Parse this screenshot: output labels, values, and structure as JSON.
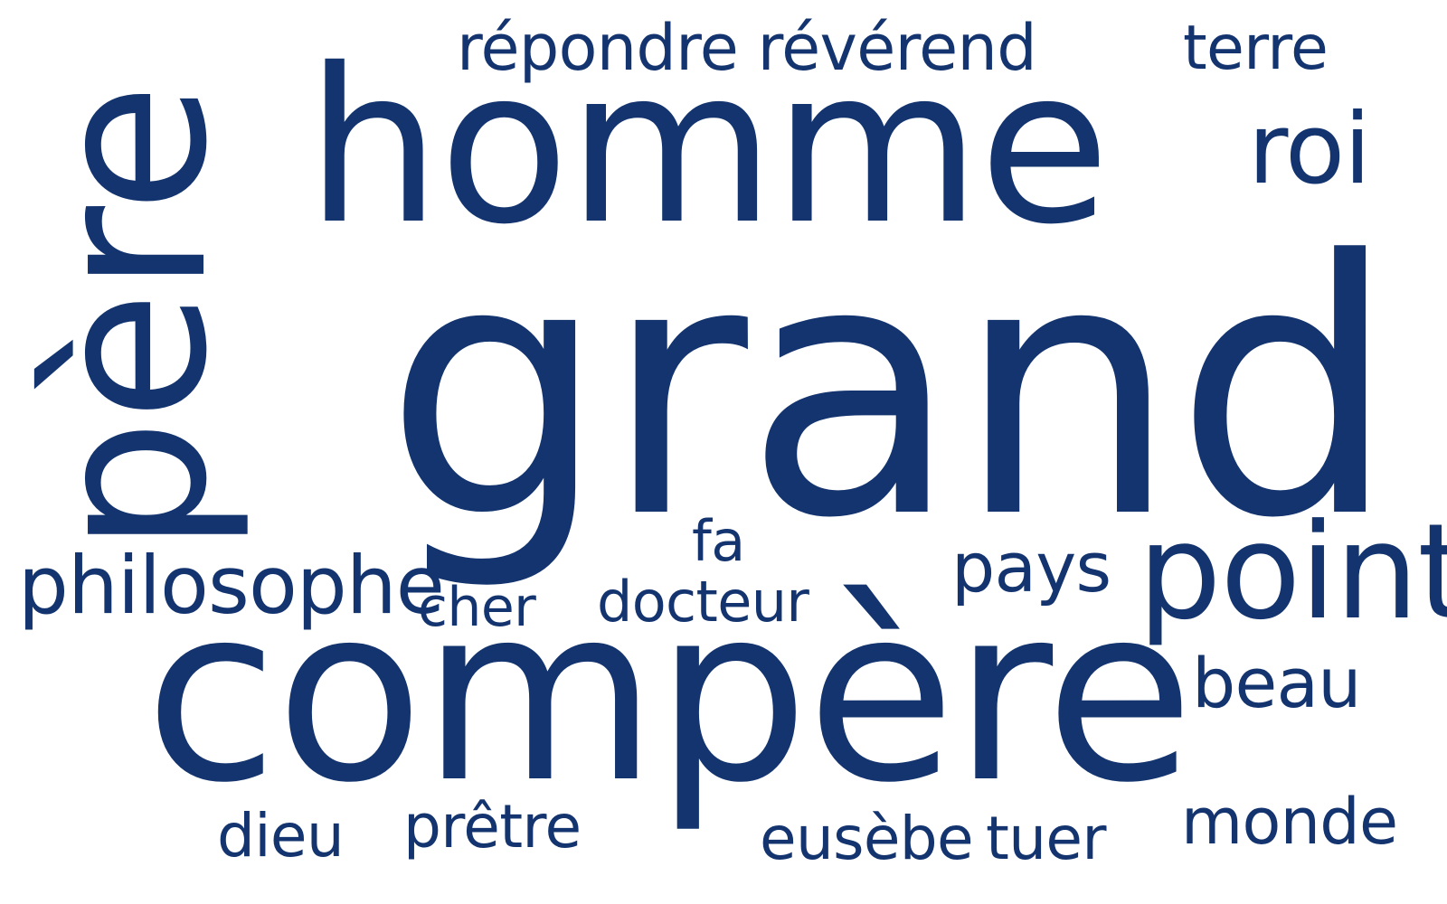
{
  "word_color": "#13346f",
  "words": {
    "grand": "grand",
    "homme": "homme",
    "pere": "père",
    "compere": "compère",
    "point": "point",
    "repondre_reverend": "répondre révérend",
    "terre": "terre",
    "roi": "roi",
    "philosophe": "philosophe",
    "cher": "cher",
    "fa": "fa",
    "docteur": "docteur",
    "pays": "pays",
    "beau": "beau",
    "dieu": "dieu",
    "pretre": "prêtre",
    "eusebe": "eusèbe",
    "tuer": "tuer",
    "monde": "monde"
  }
}
